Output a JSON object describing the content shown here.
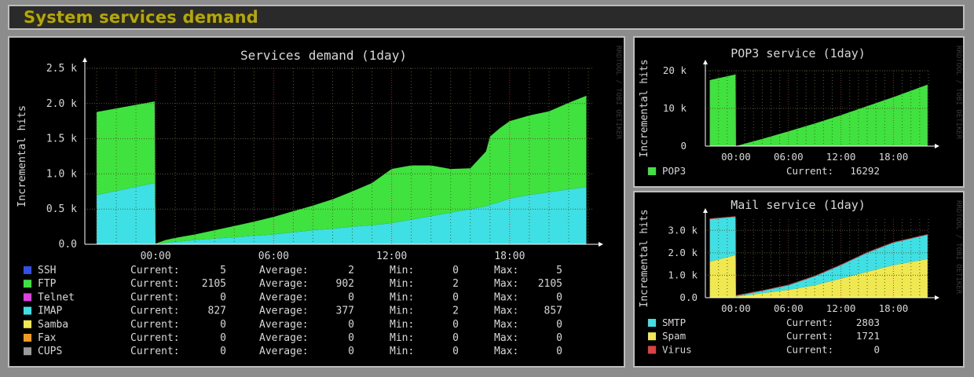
{
  "page": {
    "title": "System services demand"
  },
  "watermark": "RRDTOOL / TOBI OETIKER",
  "colors": {
    "title": "#b5a800",
    "grid": "#5a5a20",
    "canvas": "#000000"
  },
  "chart_data": [
    {
      "id": "main",
      "type": "area",
      "title": "Services demand  (1day)",
      "ylabel": "Incremental hits",
      "yticks": [
        "0.0",
        "0.5 k",
        "1.0 k",
        "1.5 k",
        "2.0 k",
        "2.5 k"
      ],
      "ylim": [
        0,
        2500
      ],
      "xticks": [
        "00:00",
        "06:00",
        "12:00",
        "18:00"
      ],
      "x": [
        -3.0,
        -0.05,
        0.0,
        0.5,
        1,
        2,
        3,
        4,
        5,
        6,
        7,
        8,
        9,
        10,
        11,
        12,
        13,
        14,
        15,
        16,
        16.8,
        17,
        17.5,
        18,
        19,
        20,
        21,
        21.9
      ],
      "stacked": true,
      "series": [
        {
          "name": "IMAP",
          "color": "#3ee0e6",
          "values": [
            700,
            870,
            0,
            20,
            35,
            60,
            80,
            100,
            120,
            140,
            170,
            200,
            220,
            250,
            270,
            300,
            350,
            400,
            450,
            500,
            540,
            560,
            600,
            650,
            700,
            740,
            780,
            810
          ]
        },
        {
          "name": "FTP",
          "color": "#3fe23f",
          "values": [
            1180,
            1160,
            10,
            40,
            55,
            80,
            120,
            160,
            200,
            250,
            300,
            350,
            420,
            500,
            600,
            770,
            770,
            720,
            620,
            580,
            780,
            970,
            1050,
            1100,
            1130,
            1150,
            1230,
            1300
          ]
        }
      ],
      "legend": [
        {
          "name": "SSH",
          "color": "#3050e8",
          "current": "5",
          "average": "2",
          "min": "0",
          "max": "5"
        },
        {
          "name": "FTP",
          "color": "#3fe23f",
          "current": "2105",
          "average": "902",
          "min": "2",
          "max": "2105"
        },
        {
          "name": "Telnet",
          "color": "#e040e0",
          "current": "0",
          "average": "0",
          "min": "0",
          "max": "0"
        },
        {
          "name": "IMAP",
          "color": "#3ee0e6",
          "current": "827",
          "average": "377",
          "min": "2",
          "max": "857"
        },
        {
          "name": "Samba",
          "color": "#f0e850",
          "current": "0",
          "average": "0",
          "min": "0",
          "max": "0"
        },
        {
          "name": "Fax",
          "color": "#f09a20",
          "current": "0",
          "average": "0",
          "min": "0",
          "max": "0"
        },
        {
          "name": "CUPS",
          "color": "#9a9a9a",
          "current": "0",
          "average": "0",
          "min": "0",
          "max": "0"
        }
      ],
      "labels": {
        "current": "Current:",
        "average": "Average:",
        "min": "Min:",
        "max": "Max:"
      }
    },
    {
      "id": "pop3",
      "type": "area",
      "title": "POP3 service  (1day)",
      "ylabel": "Incremental hits",
      "yticks": [
        "0",
        "10 k",
        "20 k"
      ],
      "ylim": [
        0,
        20000
      ],
      "xticks": [
        "00:00",
        "06:00",
        "12:00",
        "18:00"
      ],
      "x": [
        -3.0,
        -0.05,
        0.0,
        3,
        6,
        9,
        12,
        15,
        18,
        21.9
      ],
      "stacked": true,
      "series": [
        {
          "name": "POP3",
          "color": "#3fe23f",
          "values": [
            17500,
            19000,
            0,
            1900,
            3900,
            6000,
            8200,
            10600,
            13000,
            16300
          ]
        }
      ],
      "legend": [
        {
          "name": "POP3",
          "color": "#3fe23f",
          "current": "16292"
        }
      ],
      "labels": {
        "current": "Current:"
      }
    },
    {
      "id": "mail",
      "type": "area",
      "title": "Mail service  (1day)",
      "ylabel": "Incremental hits",
      "yticks": [
        "0.0",
        "1.0 k",
        "2.0 k",
        "3.0 k"
      ],
      "ylim": [
        0,
        3500
      ],
      "xticks": [
        "00:00",
        "06:00",
        "12:00",
        "18:00"
      ],
      "x": [
        -3.0,
        -0.05,
        0.0,
        3,
        6,
        9,
        12,
        15,
        18,
        21.9
      ],
      "stacked": true,
      "series": [
        {
          "name": "Spam",
          "color": "#f0e850",
          "values": [
            1600,
            1900,
            50,
            200,
            350,
            550,
            850,
            1150,
            1450,
            1721
          ]
        },
        {
          "name": "SMTP",
          "color": "#3ee0e6",
          "values": [
            1900,
            1700,
            30,
            100,
            200,
            400,
            600,
            850,
            1000,
            1082
          ]
        },
        {
          "name": "Virus",
          "color": "#e04040",
          "values": [
            30,
            30,
            30,
            30,
            30,
            30,
            30,
            30,
            30,
            30
          ]
        }
      ],
      "legend": [
        {
          "name": "SMTP",
          "color": "#3ee0e6",
          "current": "2803"
        },
        {
          "name": "Spam",
          "color": "#f0e850",
          "current": "1721"
        },
        {
          "name": "Virus",
          "color": "#e04040",
          "current": "0"
        }
      ],
      "labels": {
        "current": "Current:"
      }
    }
  ]
}
